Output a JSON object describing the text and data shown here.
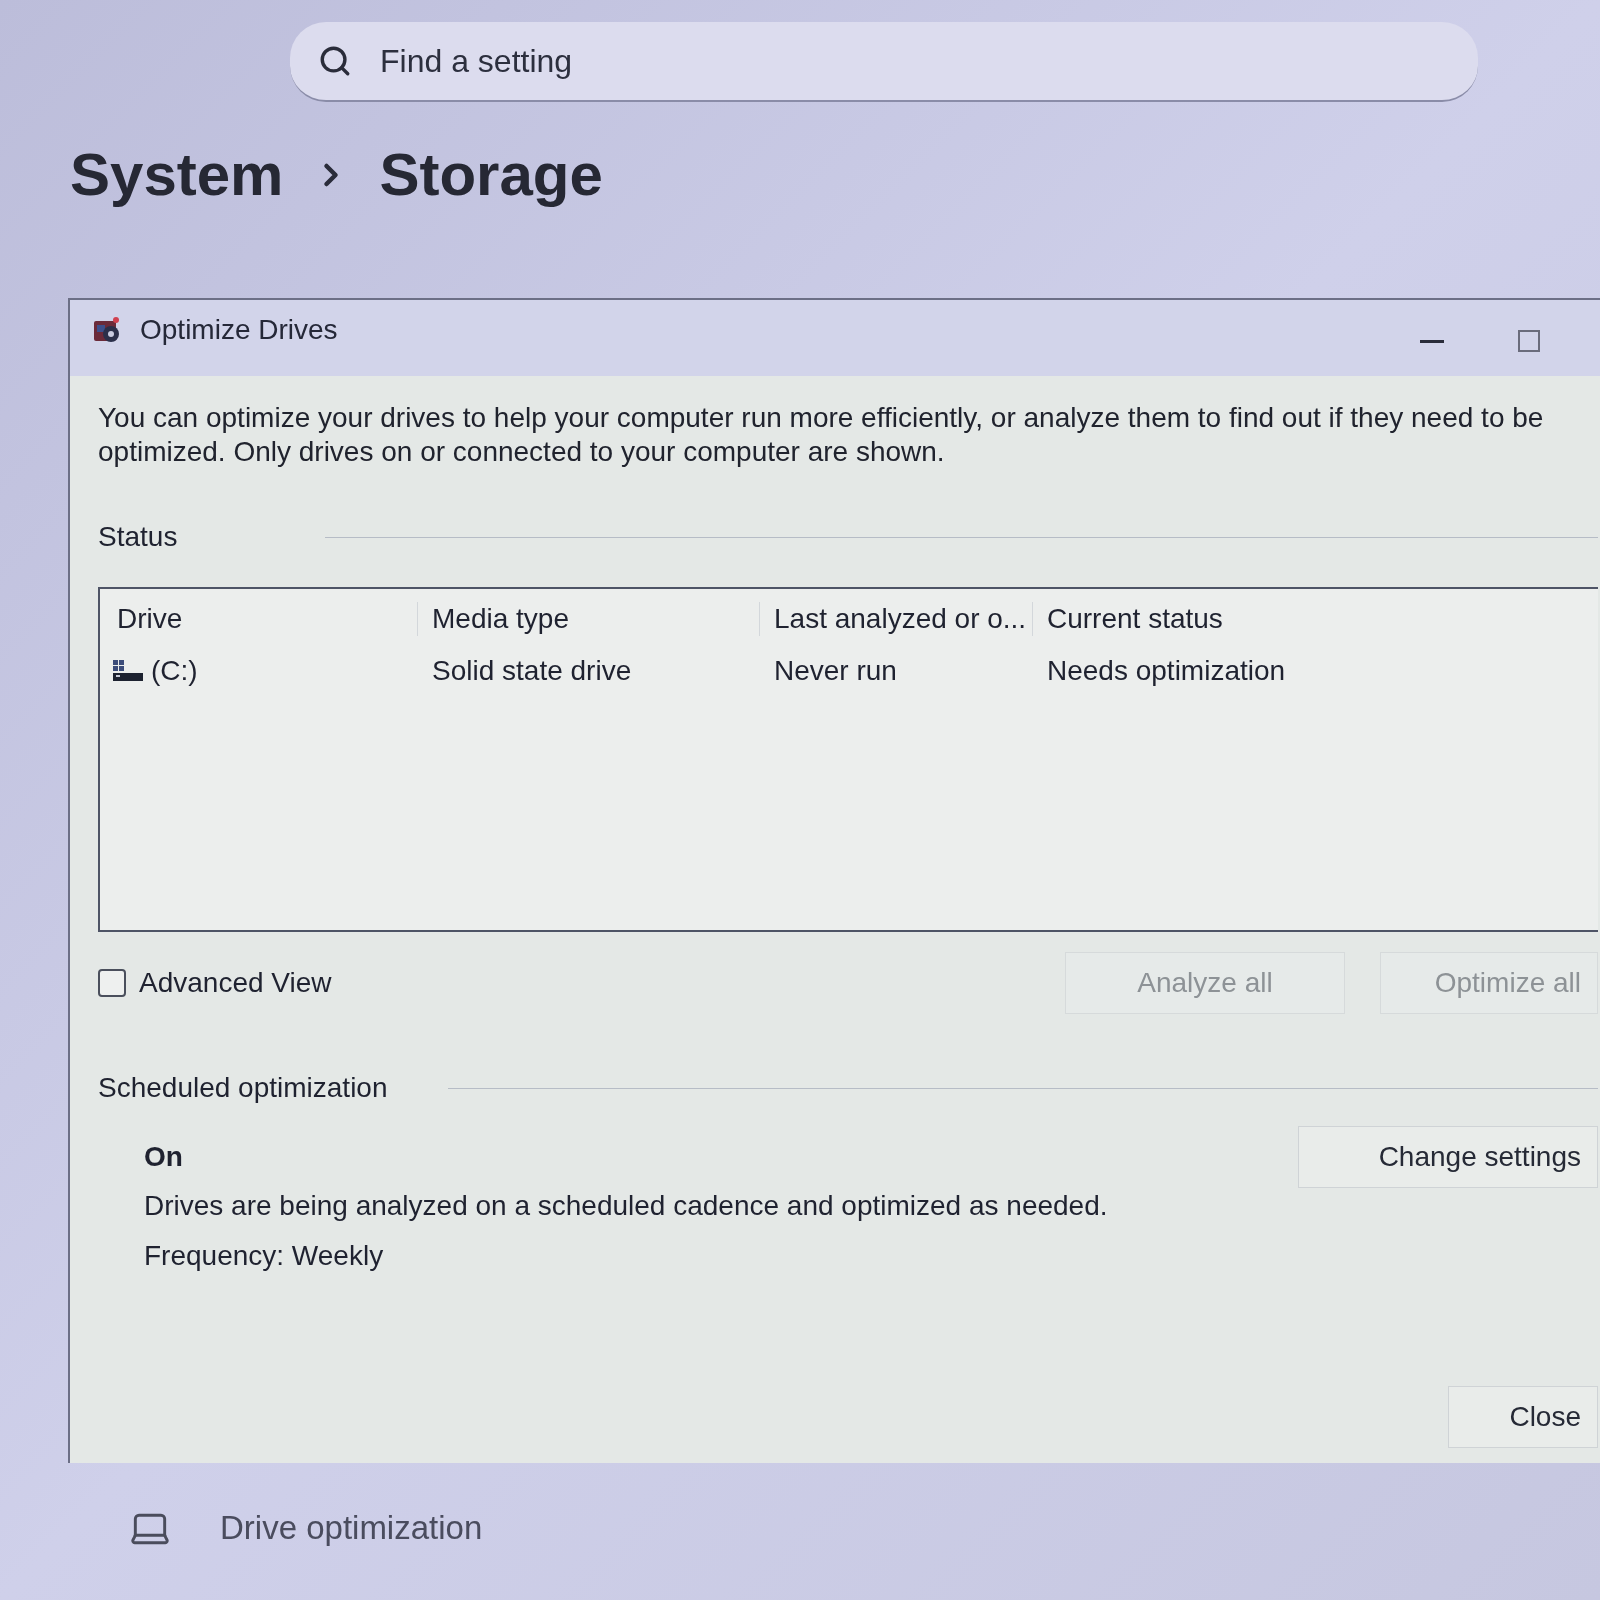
{
  "search": {
    "placeholder": "Find a setting"
  },
  "breadcrumb": [
    {
      "label": "System"
    },
    {
      "label": "Storage"
    }
  ],
  "dialog": {
    "title": "Optimize Drives",
    "description": "You can optimize your drives to help your computer run more efficiently, or analyze them to find out if they need to be optimized. Only drives on or connected to your computer are shown.",
    "status_label": "Status",
    "table": {
      "columns": [
        "Drive",
        "Media type",
        "Last analyzed or o...",
        "Current status"
      ],
      "rows": [
        {
          "cells": [
            "(C:)",
            "Solid state drive",
            "Never run",
            "Needs optimization"
          ]
        }
      ]
    },
    "advanced_view": {
      "label": "Advanced View",
      "checked": false
    },
    "buttons": [
      {
        "label": "Analyze all",
        "disabled": true
      },
      {
        "label": "Optimize all",
        "disabled": true
      }
    ],
    "scheduled": {
      "heading": "Scheduled optimization",
      "state": "On",
      "description": "Drives are being analyzed on a scheduled cadence and optimized as needed.",
      "frequency": "Frequency: Weekly",
      "button": {
        "label": "Change settings",
        "disabled": false
      }
    },
    "close_button": {
      "label": "Close",
      "disabled": false
    }
  },
  "settings_item": {
    "label": "Drive optimization"
  }
}
